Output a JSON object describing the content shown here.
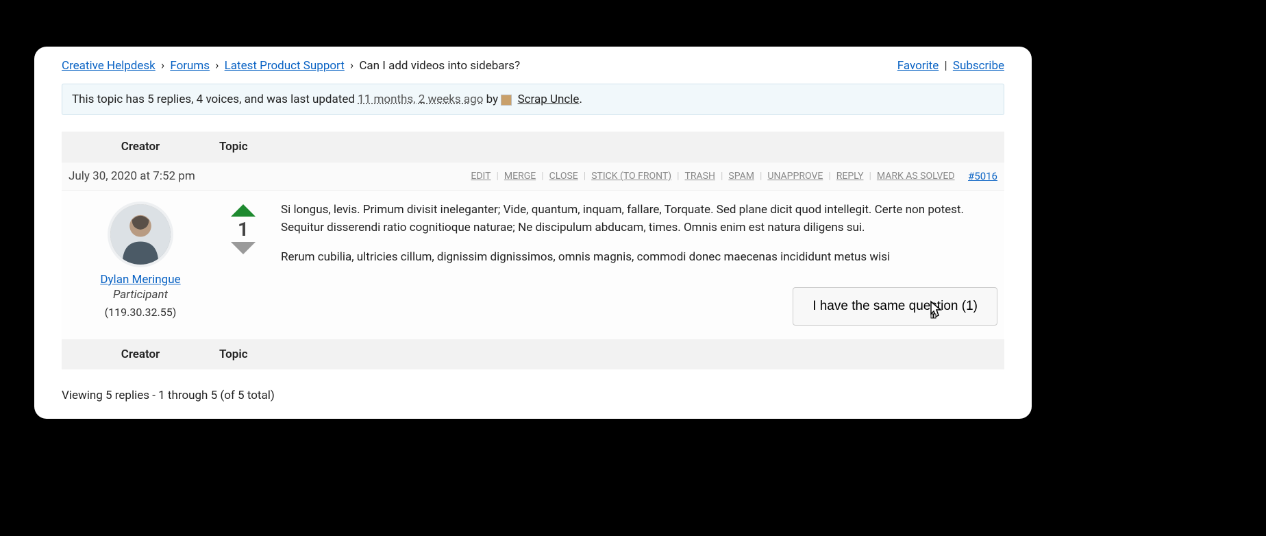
{
  "breadcrumb": {
    "items": [
      "Creative Helpdesk",
      "Forums",
      "Latest Product Support"
    ],
    "current": "Can I add videos into sidebars?"
  },
  "top_actions": {
    "favorite": "Favorite",
    "subscribe": "Subscribe"
  },
  "notice": {
    "prefix": "This topic has 5 replies, 4 voices, and was last updated ",
    "time": "11 months, 2 weeks ago",
    "by": " by ",
    "user": "Scrap Uncle",
    "suffix": "."
  },
  "headers": {
    "creator": "Creator",
    "topic": "Topic"
  },
  "post": {
    "date": "July 30, 2020 at 7:52 pm",
    "mod_links": [
      "EDIT",
      "MERGE",
      "CLOSE",
      "STICK (TO FRONT)",
      "TRASH",
      "SPAM",
      "UNAPPROVE",
      "REPLY",
      "MARK AS SOLVED"
    ],
    "post_number": "#5016",
    "author": {
      "name": "Dylan Meringue",
      "role": "Participant",
      "ip": "(119.30.32.55)"
    },
    "vote_count": "1",
    "content": {
      "p1": "Si longus, levis. Primum divisit ineleganter; Vide, quantum, inquam, fallare, Torquate. Sed plane dicit quod intellegit. Certe non potest. Sequitur disserendi ratio cognitioque naturae; Ne discipulum abducam, times. Omnis enim est natura diligens sui.",
      "p2": "Rerum cubilia, ultricies cillum, dignissim dignissimos, omnis magnis, commodi donec maecenas incididunt metus wisi"
    },
    "same_question": "I have the same question (1)"
  },
  "viewing": "Viewing 5 replies - 1 through 5 (of 5 total)"
}
